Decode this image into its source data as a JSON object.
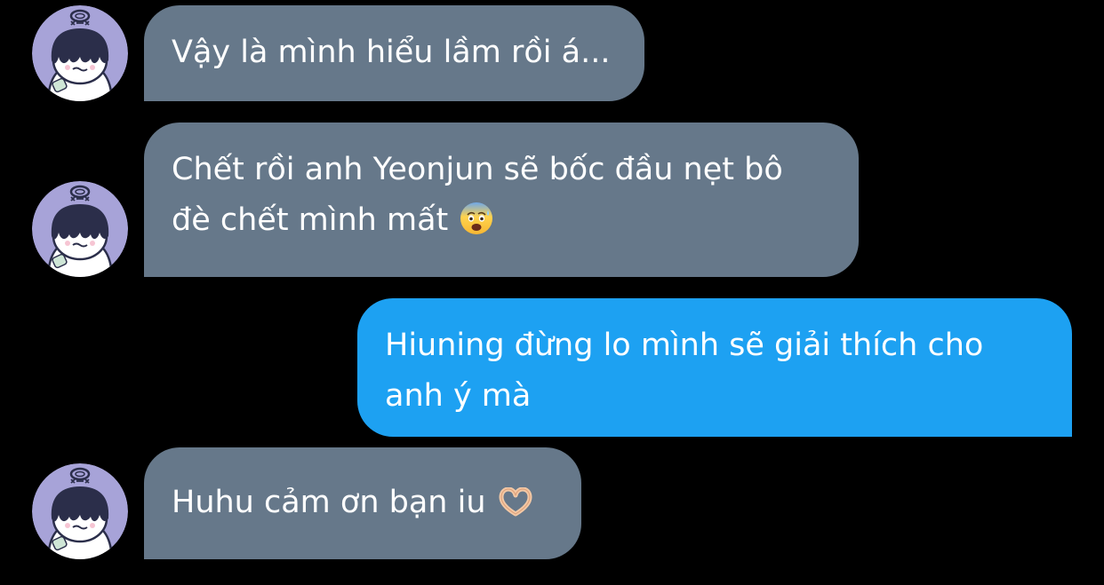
{
  "colors": {
    "background": "#000000",
    "incoming_bubble": "#66788a",
    "outgoing_bubble": "#1da1f2",
    "text": "#ffffff",
    "avatar_bg": "#a7a3d8"
  },
  "messages": [
    {
      "direction": "incoming",
      "avatar": "ghost-avatar-icon",
      "lines": [
        "Vậy là mình hiểu lầm rồi á..."
      ]
    },
    {
      "direction": "incoming",
      "avatar": "ghost-avatar-icon",
      "lines": [
        "Chết rồi anh Yeonjun sẽ bốc đầu nẹt bô",
        "đè chết mình mất"
      ],
      "emoji": "anxious-face-emoji"
    },
    {
      "direction": "outgoing",
      "lines": [
        "Hiuning đừng lo mình sẽ giải thích cho",
        "anh ý mà"
      ]
    },
    {
      "direction": "incoming",
      "avatar": "ghost-avatar-icon",
      "lines": [
        "Huhu cảm ơn bạn iu"
      ],
      "emoji": "heart-hands-emoji"
    }
  ]
}
